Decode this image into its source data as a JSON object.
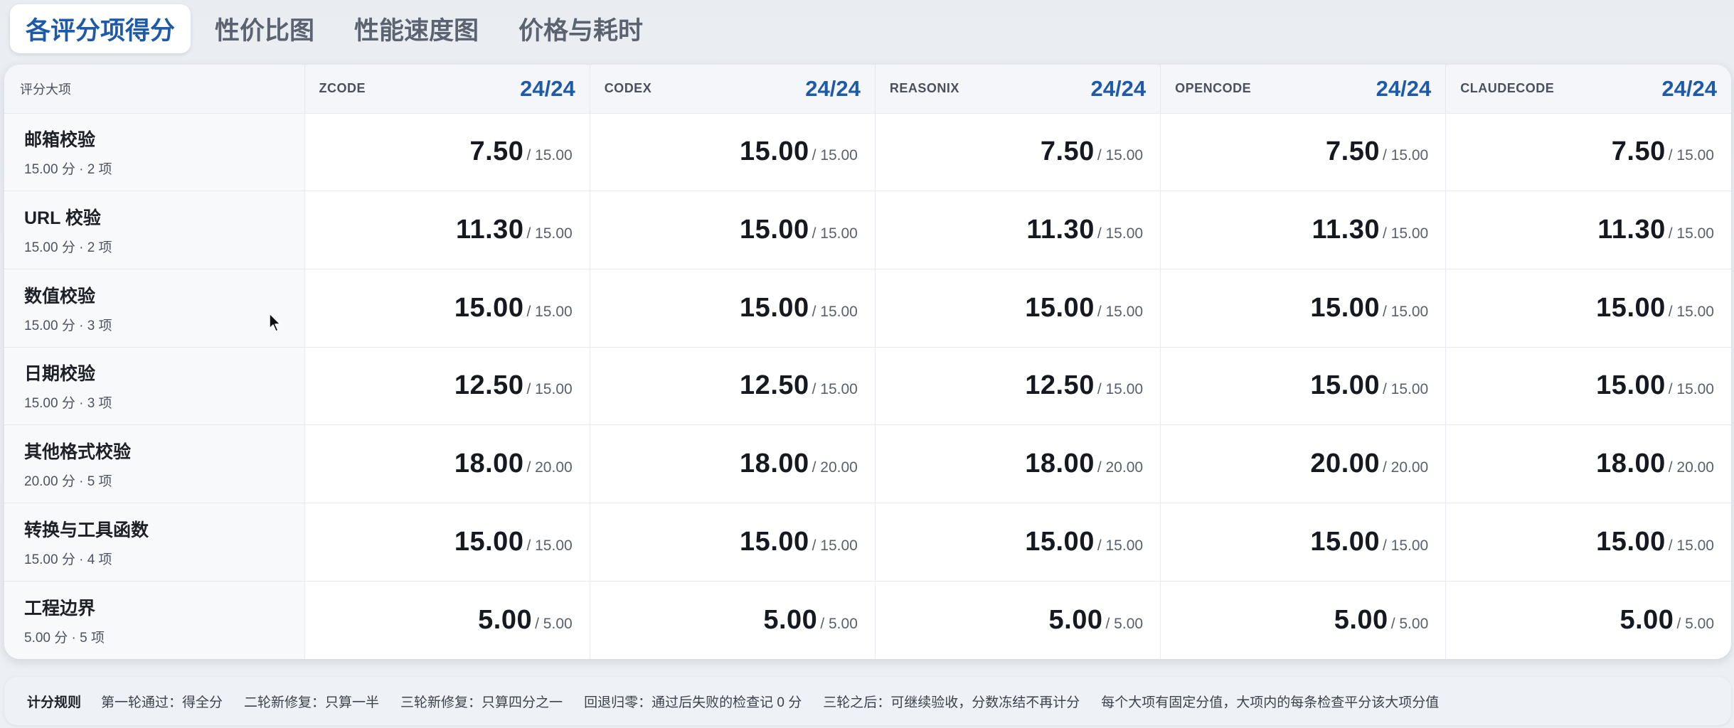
{
  "tabs": [
    {
      "label": "各评分项得分"
    },
    {
      "label": "性价比图"
    },
    {
      "label": "性能速度图"
    },
    {
      "label": "价格与耗时"
    }
  ],
  "table": {
    "category_header": "评分大项",
    "models": [
      {
        "name": "ZCODE",
        "pass": "24/24"
      },
      {
        "name": "CODEX",
        "pass": "24/24"
      },
      {
        "name": "REASONIX",
        "pass": "24/24"
      },
      {
        "name": "OPENCODE",
        "pass": "24/24"
      },
      {
        "name": "CLAUDECODE",
        "pass": "24/24"
      }
    ],
    "rows": [
      {
        "name": "邮箱校验",
        "meta": "15.00 分 · 2 项",
        "max": "/ 15.00",
        "scores": [
          "7.50",
          "15.00",
          "7.50",
          "7.50",
          "7.50"
        ]
      },
      {
        "name": "URL 校验",
        "meta": "15.00 分 · 2 项",
        "max": "/ 15.00",
        "scores": [
          "11.30",
          "15.00",
          "11.30",
          "11.30",
          "11.30"
        ]
      },
      {
        "name": "数值校验",
        "meta": "15.00 分 · 3 项",
        "max": "/ 15.00",
        "scores": [
          "15.00",
          "15.00",
          "15.00",
          "15.00",
          "15.00"
        ]
      },
      {
        "name": "日期校验",
        "meta": "15.00 分 · 3 项",
        "max": "/ 15.00",
        "scores": [
          "12.50",
          "12.50",
          "12.50",
          "15.00",
          "15.00"
        ]
      },
      {
        "name": "其他格式校验",
        "meta": "20.00 分 · 5 项",
        "max": "/ 20.00",
        "scores": [
          "18.00",
          "18.00",
          "18.00",
          "20.00",
          "18.00"
        ]
      },
      {
        "name": "转换与工具函数",
        "meta": "15.00 分 · 4 项",
        "max": "/ 15.00",
        "scores": [
          "15.00",
          "15.00",
          "15.00",
          "15.00",
          "15.00"
        ]
      },
      {
        "name": "工程边界",
        "meta": "5.00 分 · 5 项",
        "max": "/ 5.00",
        "scores": [
          "5.00",
          "5.00",
          "5.00",
          "5.00",
          "5.00"
        ]
      }
    ]
  },
  "rules": {
    "title": "计分规则",
    "items": [
      "第一轮通过：得全分",
      "二轮新修复：只算一半",
      "三轮新修复：只算四分之一",
      "回退归零：通过后失败的检查记 0 分",
      "三轮之后：可继续验收，分数冻结不再计分",
      "每个大项有固定分值，大项内的每条检查平分该大项分值"
    ]
  },
  "cursor": {
    "icon": "mouse-pointer-icon"
  }
}
